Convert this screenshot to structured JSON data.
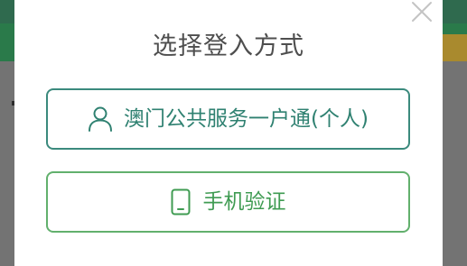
{
  "dialog": {
    "title": "选择登入方式",
    "close_icon": "close-icon",
    "options": [
      {
        "label": "澳门公共服务一户通(个人)",
        "icon": "user-icon",
        "color": "#2f8171"
      },
      {
        "label": "手机验证",
        "icon": "mobile-phone-icon",
        "color": "#3f9b52"
      }
    ]
  }
}
